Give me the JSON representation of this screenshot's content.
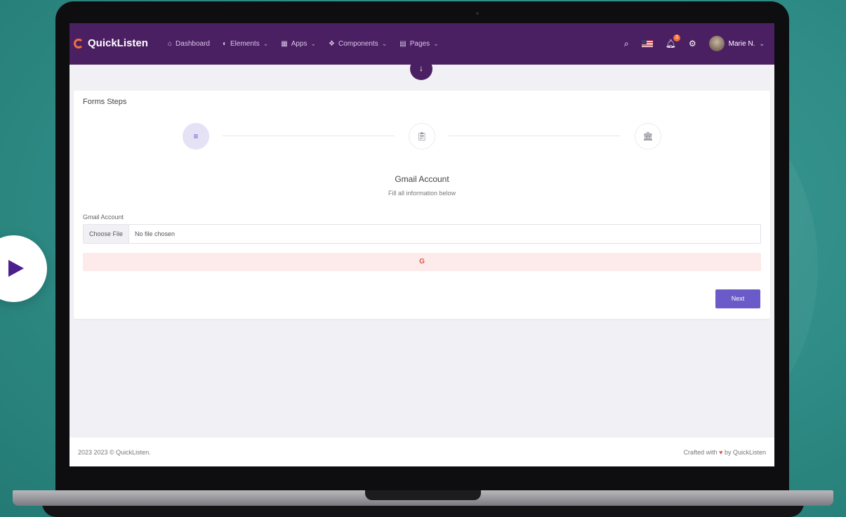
{
  "brand": {
    "name": "QuickListen"
  },
  "nav": {
    "items": [
      {
        "label": "Dashboard",
        "icon": "home-icon",
        "dropdown": false
      },
      {
        "label": "Elements",
        "icon": "circle-half-icon",
        "dropdown": true
      },
      {
        "label": "Apps",
        "icon": "grid-icon",
        "dropdown": true
      },
      {
        "label": "Components",
        "icon": "cube-icon",
        "dropdown": true
      },
      {
        "label": "Pages",
        "icon": "page-icon",
        "dropdown": true
      }
    ]
  },
  "header": {
    "notification_count": "3",
    "user_name": "Marie N."
  },
  "card": {
    "title": "Forms Steps",
    "heading": "Gmail Account",
    "subheading": "Fill all information below",
    "field_label": "Gmail Account",
    "file_button": "Choose File",
    "file_status": "No file chosen",
    "alert_text": "G",
    "next_label": "Next"
  },
  "footer": {
    "left": "2023 2023 © QuickListen.",
    "right_prefix": "Crafted with",
    "right_suffix": "by QuickListen"
  },
  "colors": {
    "topbar": "#4b2063",
    "accent": "#6b5bc9",
    "brand_logo": "#f0703a",
    "alert_bg": "#fcebea",
    "alert_text": "#d9534f"
  }
}
